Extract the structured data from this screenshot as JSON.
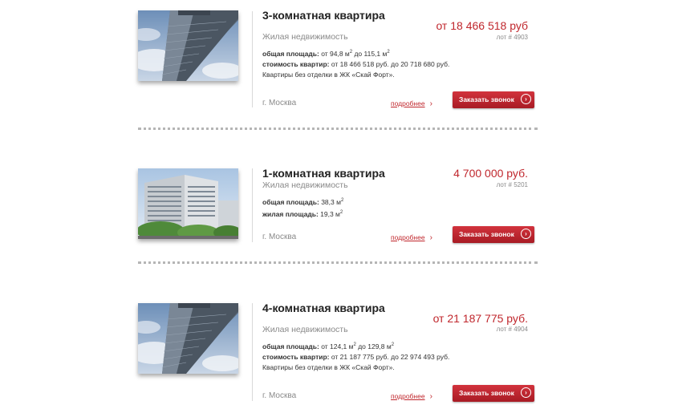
{
  "listings": [
    {
      "title": "3-комнатная квартира",
      "category": "Жилая недвижимость",
      "price": "от 18 466 518 руб",
      "lot": "лот # 4903",
      "spec1_label": "общая площадь:",
      "spec1_value": " от 94,8 м",
      "spec1_mid": " до 115,1 м",
      "spec2_label": "стоимость квартир:",
      "spec2_value": " от 18 466 518 руб. до 20 718 680 руб.",
      "spec3": "Квартиры без отделки в ЖК «Скай Форт».",
      "city": "г. Москва",
      "more": "подробнее",
      "call": "Заказать звонок",
      "photo_icon": "skyscraper-photo"
    },
    {
      "title": "1-комнатная квартира",
      "category": "Жилая недвижимость",
      "price": "4 700 000 руб.",
      "lot": "лот # 5201",
      "spec1_label": "общая площадь:",
      "spec1_value": " 38,3 м",
      "spec2_label": "жилая площадь:",
      "spec2_value": " 19,3 м",
      "city": "г. Москва",
      "more": "подробнее",
      "call": "Заказать звонок",
      "photo_icon": "apartment-block-photo"
    },
    {
      "title": "4-комнатная квартира",
      "category": "Жилая недвижимость",
      "price": "от 21 187 775 руб.",
      "lot": "лот # 4904",
      "spec1_label": "общая площадь:",
      "spec1_value": " от 124,1 м",
      "spec1_mid": " до 129,8 м",
      "spec2_label": "стоимость квартир:",
      "spec2_value": " от 21 187 775 руб. до 22 974 493 руб.",
      "spec3": "Квартиры без отделки в ЖК «Скай Форт».",
      "city": "г. Москва",
      "more": "подробнее",
      "call": "Заказать звонок",
      "photo_icon": "skyscraper-photo"
    }
  ],
  "unit_sup": "2",
  "chevron": "›",
  "arrow": "›",
  "colors": {
    "accent": "#c0272d",
    "button": "#b8212b",
    "muted": "#8a8a8a",
    "divider": "#b5b5b5"
  }
}
